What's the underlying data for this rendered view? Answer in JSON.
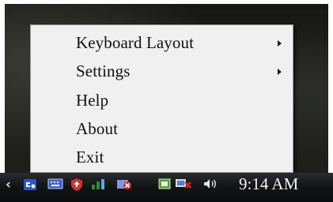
{
  "context_menu": {
    "items": [
      {
        "label": "Keyboard Layout",
        "has_submenu": true
      },
      {
        "label": "Settings",
        "has_submenu": true
      },
      {
        "label": "Help",
        "has_submenu": false
      },
      {
        "label": "About",
        "has_submenu": false
      },
      {
        "label": "Exit",
        "has_submenu": false
      }
    ]
  },
  "taskbar": {
    "clock": "9:14 AM",
    "tray_icons": [
      "show-hidden-icons-chevron",
      "ime-icon",
      "keyboard-icon",
      "security-shield-icon",
      "network-icon",
      "blocked-app-icon",
      "storage-icon",
      "network-disconnected-icon",
      "volume-icon"
    ]
  },
  "colors": {
    "menu_background": "#f0f0f0",
    "taskbar": "#121315",
    "clock_text": "#f2f2f2",
    "desktop": "#1f201d"
  }
}
